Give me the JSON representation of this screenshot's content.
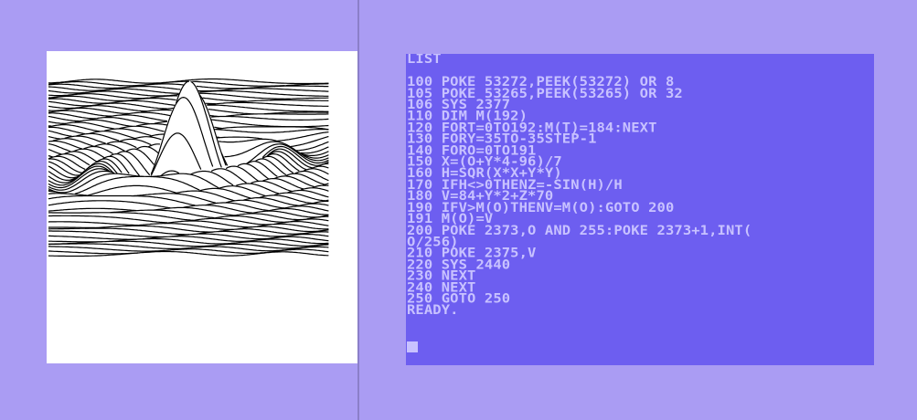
{
  "plot": {
    "icon": "wireframe-surface-plot"
  },
  "terminal": {
    "lines": [
      "LIST",
      "",
      "100 POKE 53272,PEEK(53272) OR 8",
      "105 POKE 53265,PEEK(53265) OR 32",
      "106 SYS 2377",
      "110 DIM M(192)",
      "120 FORT=0TO192:M(T)=184:NEXT",
      "130 FORY=35TO-35STEP-1",
      "140 FORO=0TO191",
      "150 X=(O+Y*4-96)/7",
      "160 H=SQR(X*X+Y*Y)",
      "170 IFH<>0THENZ=-SIN(H)/H",
      "180 V=84+Y*2+Z*70",
      "190 IFV>M(O)THENV=M(O):GOTO 200",
      "191 M(O)=V",
      "200 POKE 2373,O AND 255:POKE 2373+1,INT(",
      "O/256)",
      "210 POKE 2375,V",
      "220 SYS 2440",
      "230 NEXT",
      "240 NEXT",
      "250 GOTO 250",
      "READY."
    ]
  },
  "colors": {
    "border": "#aa9cf3",
    "screen_bg": "#6d5ef0",
    "screen_text": "#c8c2ff",
    "plot_bg": "#ffffff",
    "plot_ink": "#000000"
  }
}
